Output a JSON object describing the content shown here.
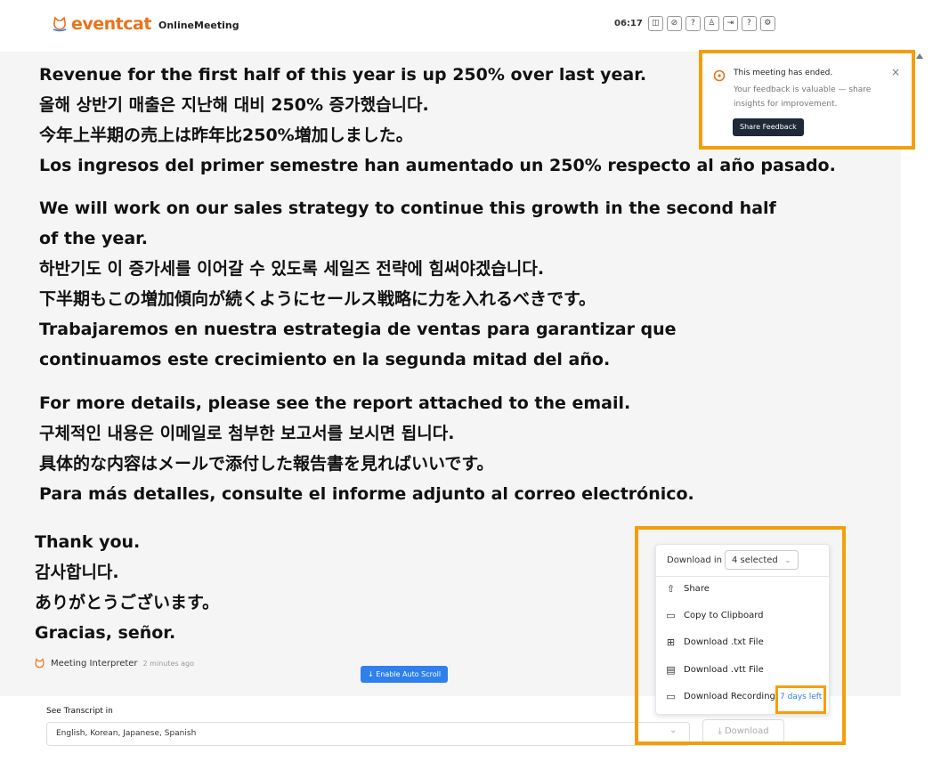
{
  "header": {
    "logo_part1": "event",
    "logo_part2": "cat",
    "app_name": "OnlineMeeting",
    "clock": "06:17"
  },
  "transcript": {
    "blocks": [
      {
        "lines": [
          "Revenue for the first half of this year is up 250% over last year.",
          "올해 상반기 매출은 지난해 대비 250% 증가했습니다.",
          "今年上半期の売上は昨年比250%増加しました。",
          "Los ingresos del primer semestre han aumentado un 250% respecto al año pasado."
        ]
      },
      {
        "lines": [
          "We will work on our sales strategy to continue this growth in the second half of the year.",
          "하반기도 이 증가세를 이어갈 수 있도록 세일즈 전략에 힘써야겠습니다.",
          "下半期もこの増加傾向が続くようにセールス戦略に力を入れるべきです。",
          "Trabajaremos en nuestra estrategia de ventas para garantizar que continuamos este crecimiento en la segunda mitad del año."
        ]
      },
      {
        "lines": [
          "For more details, please see the report attached to the email.",
          "구체적인 내용은 이메일로 첨부한 보고서를 보시면 됩니다.",
          "具体的な内容はメールで添付した報告書を見ればいいです。",
          "Para más detalles, consulte el informe adjunto al correo electrónico."
        ]
      },
      {
        "lines": [
          "Thank you.",
          "감사합니다.",
          "ありがとうございます。",
          "Gracias, señor."
        ]
      }
    ],
    "speaker": "Meeting Interpreter",
    "speaker_time": "2 minutes ago",
    "auto_scroll_label": "Enable Auto Scroll"
  },
  "feedback": {
    "title": "This meeting has ended.",
    "body": "Your feedback is valuable — share insights for improvement.",
    "button": "Share Feedback",
    "close": "×"
  },
  "bottom": {
    "see_transcript_label": "See Transcript in",
    "languages_value": "English, Korean, Japanese, Spanish",
    "download_button": "Download"
  },
  "download_menu": {
    "download_in_label": "Download in",
    "selected": "4 selected",
    "items": [
      {
        "label": "Share",
        "icon": "share-icon"
      },
      {
        "label": "Copy to Clipboard",
        "icon": "clipboard-icon"
      },
      {
        "label": "Download .txt File",
        "icon": "file-icon"
      },
      {
        "label": "Download .vtt File",
        "icon": "subtitle-icon"
      },
      {
        "label": "Download Recording",
        "icon": "video-icon"
      }
    ],
    "days_left": "7 days left"
  },
  "colors": {
    "brand": "#e8731a",
    "highlight": "#f59e0b",
    "accent_blue": "#2f80ed",
    "dark_button": "#1f2937"
  }
}
